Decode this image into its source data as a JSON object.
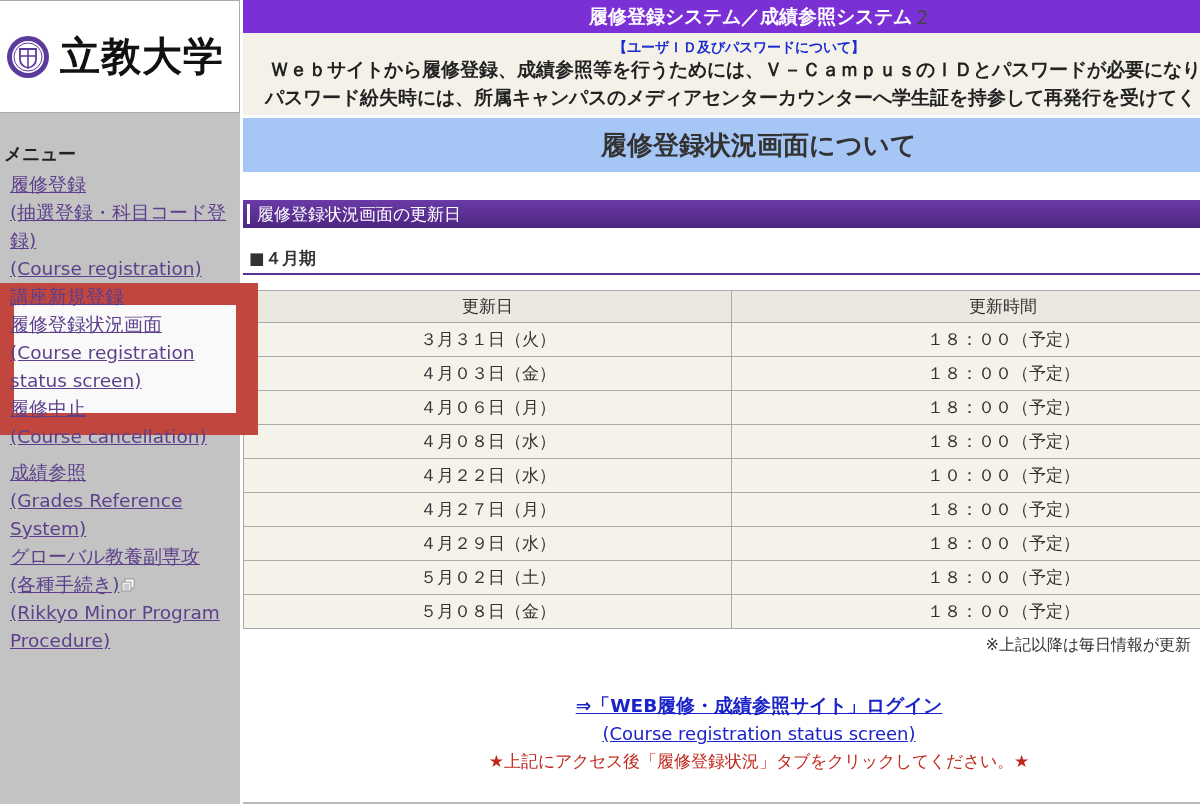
{
  "logo": {
    "text": "立教大学"
  },
  "sidebar": {
    "heading": "メニュー",
    "menu_groups": [
      [
        {
          "highlighted": false,
          "lines": [
            {
              "kind": "link",
              "text": "履修登録"
            },
            {
              "kind": "link",
              "text": "(抽選登録・科目コード登録)"
            },
            {
              "kind": "link",
              "text": "(Course registration)"
            }
          ]
        },
        {
          "highlighted": false,
          "lines": [
            {
              "kind": "link",
              "text": "講座新規登録"
            }
          ]
        },
        {
          "highlighted": true,
          "lines": [
            {
              "kind": "link",
              "text": "履修登録状況画面"
            },
            {
              "kind": "link",
              "text": "(Course registration status screen)"
            }
          ]
        },
        {
          "highlighted": false,
          "lines": [
            {
              "kind": "link",
              "text": "履修中止"
            },
            {
              "kind": "link",
              "text": "(Course cancellation)"
            }
          ]
        }
      ],
      [
        {
          "highlighted": false,
          "lines": [
            {
              "kind": "link",
              "text": "成績参照"
            },
            {
              "kind": "link",
              "text": "(Grades Reference System)"
            }
          ]
        },
        {
          "highlighted": false,
          "lines": [
            {
              "kind": "link",
              "text": "グローバル教養副専攻"
            },
            {
              "kind": "window-link",
              "text": "(各種手続き)"
            },
            {
              "kind": "link",
              "text": "(Rikkyo Minor Program Procedure)"
            }
          ]
        }
      ]
    ]
  },
  "header": {
    "title": "履修登録システム／成績参照システム",
    "suffix": "2",
    "notice_link": "【ユーザＩＤ及びパスワードについて】",
    "notice_lines": [
      "Ｗｅｂサイトから履修登録、成績参照等を行うためには、Ｖ－ＣａｍｐｕｓのＩＤとパスワードが必要になり",
      "パスワード紛失時には、所属キャンパスのメディアセンターカウンターへ学生証を持参して再発行を受けてく"
    ]
  },
  "page_title": "履修登録状況画面について",
  "section_title": "履修登録状況画面の更新日",
  "period_heading": "■４月期",
  "table": {
    "columns": [
      "更新日",
      "更新時間"
    ],
    "rows": [
      [
        "３月３１日（火）",
        "１８：００（予定）"
      ],
      [
        "４月０３日（金）",
        "１８：００（予定）"
      ],
      [
        "４月０６日（月）",
        "１８：００（予定）"
      ],
      [
        "４月０８日（水）",
        "１８：００（予定）"
      ],
      [
        "４月２２日（水）",
        "１０：００（予定）"
      ],
      [
        "４月２７日（月）",
        "１８：００（予定）"
      ],
      [
        "４月２９日（水）",
        "１８：００（予定）"
      ],
      [
        "５月０２日（土）",
        "１８：００（予定）"
      ],
      [
        "５月０８日（金）",
        "１８：００（予定）"
      ]
    ]
  },
  "note": "※上記以降は毎日情報が更新",
  "footer": {
    "login_link": "⇒「WEB履修・成績参照サイト」ログイン",
    "sub_link": "(Course registration status screen)",
    "instruction": "★上記にアクセス後「履修登録状況」タブをクリックしてください。★"
  }
}
